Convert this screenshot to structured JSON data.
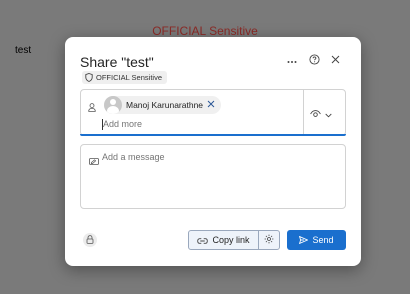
{
  "background": {
    "banner": "OFFICIAL Sensitive",
    "doc_text": "test"
  },
  "dialog": {
    "title": "Share \"test\"",
    "sensitivity_label": "OFFICIAL Sensitive",
    "header_icons": [
      "more-options-icon",
      "help-icon",
      "close-icon"
    ],
    "recipients": [
      {
        "name": "Manoj Karunarathne",
        "avatar": "default-avatar"
      }
    ],
    "add_more_placeholder": "Add more",
    "permission_icon": "eye-icon",
    "message_placeholder": "Add a message",
    "copy_link_label": "Copy link",
    "send_label": "Send",
    "colors": {
      "primary": "#1a6fce",
      "banner": "#8b2a26"
    }
  }
}
